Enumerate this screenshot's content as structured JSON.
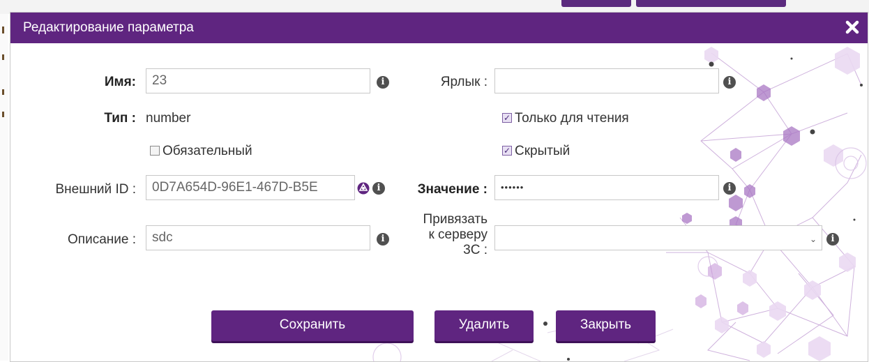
{
  "dialog": {
    "title": "Редактирование параметра",
    "close_icon": "close-icon"
  },
  "form": {
    "name": {
      "label": "Имя",
      "colon": ":",
      "value": "23"
    },
    "label_field": {
      "label": "Ярлык :",
      "value": ""
    },
    "type": {
      "label": "Тип",
      "colon": ":",
      "value": "number"
    },
    "readonly": {
      "label": "Только для чтения",
      "checked": true
    },
    "required": {
      "label": "Обязательный",
      "checked": false
    },
    "hidden": {
      "label": "Скрытый",
      "checked": true
    },
    "external_id": {
      "label": "Внешний ID :",
      "value": "0D7A654D-96E1-467D-B5E"
    },
    "value": {
      "label": "Значение :",
      "value": "••••••"
    },
    "description": {
      "label": "Описание :",
      "value": "sdc"
    },
    "bind_server": {
      "label_lines": [
        "Привязать",
        "к серверу",
        "3С :"
      ],
      "selected": ""
    }
  },
  "buttons": {
    "save": "Сохранить",
    "delete": "Удалить",
    "close": "Закрыть"
  },
  "colors": {
    "accent": "#5f2580",
    "accent_shadow": "#3e1158",
    "info_icon": "#505050"
  },
  "icons": {
    "info": "info-icon",
    "generate": "globe-generate-icon",
    "caret": "chevron-down-icon"
  }
}
